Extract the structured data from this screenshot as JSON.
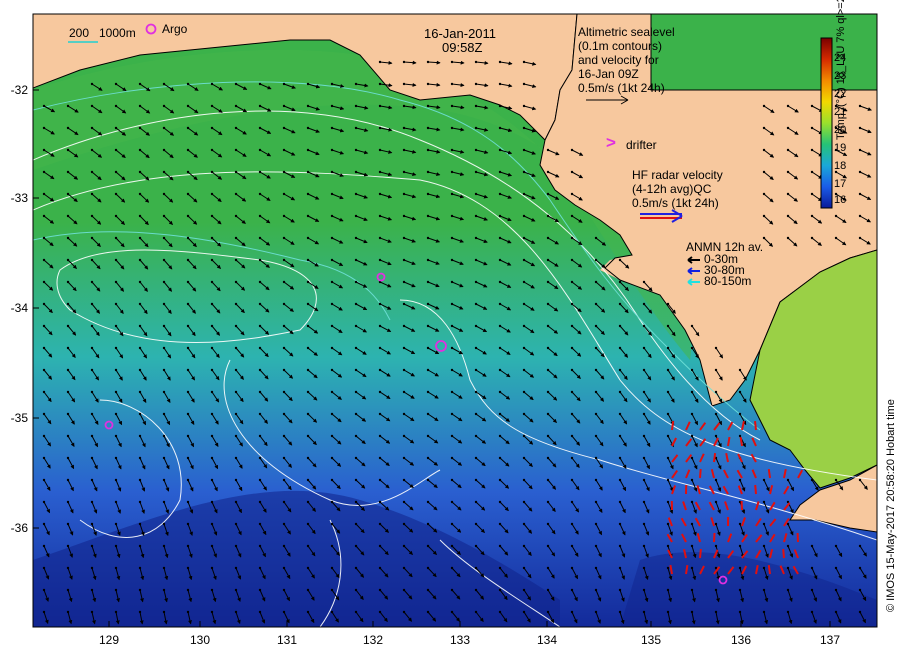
{
  "map": {
    "date": "16-Jan-2011",
    "time": "09:58Z",
    "colors": {
      "land": "#f7c89e",
      "ocean_warm": "#3bb24a",
      "ocean_mid": "#2db3b0",
      "ocean_cool": "#2a5fd0",
      "ocean_cold": "#132a9a",
      "contour": "#ffffff",
      "isobath_200": "#6fe0d8",
      "argo": "#e030e0",
      "radar": "#e01010"
    },
    "y_ticks": [
      "-32",
      "-33",
      "-34",
      "-35",
      "-36"
    ],
    "x_ticks": [
      "129",
      "130",
      "131",
      "132",
      "133",
      "134",
      "135",
      "136",
      "137"
    ]
  },
  "legend": {
    "bathy_200": "200",
    "bathy_1000": "1000m",
    "argo": "Argo",
    "altimetric": [
      "Altimetric sealevel",
      "(0.1m contours)",
      "and velocity for",
      "16-Jan 09Z",
      "0.5m/s (1kt 24h)"
    ],
    "drifter": "drifter",
    "drifter_symbol": ">",
    "hf_radar": [
      "HF radar velocity",
      "(4-12h avg)QC",
      "0.5m/s (1kt 24h)"
    ],
    "anmn": {
      "title": "ANMN 12h av.",
      "items": [
        {
          "label": "0-30m",
          "color": "#000000"
        },
        {
          "label": "30-80m",
          "color": "#1020e0"
        },
        {
          "label": "80-150m",
          "color": "#20e0e0"
        }
      ]
    }
  },
  "colorbar": {
    "ticks": [
      "24",
      "23",
      "22",
      "21",
      "20",
      "19",
      "18",
      "17",
      "16"
    ],
    "title": "Temp. (°C) 16_L3U 7% ql>=2",
    "colors": [
      "#7a0000",
      "#d42a00",
      "#f28a00",
      "#f2d800",
      "#9ae02c",
      "#26c276",
      "#1aa8d8",
      "#1a5ce8",
      "#0a1a9a"
    ]
  },
  "credit": "© IMOS 15-May-2017 20:58:20 Hobart time"
}
